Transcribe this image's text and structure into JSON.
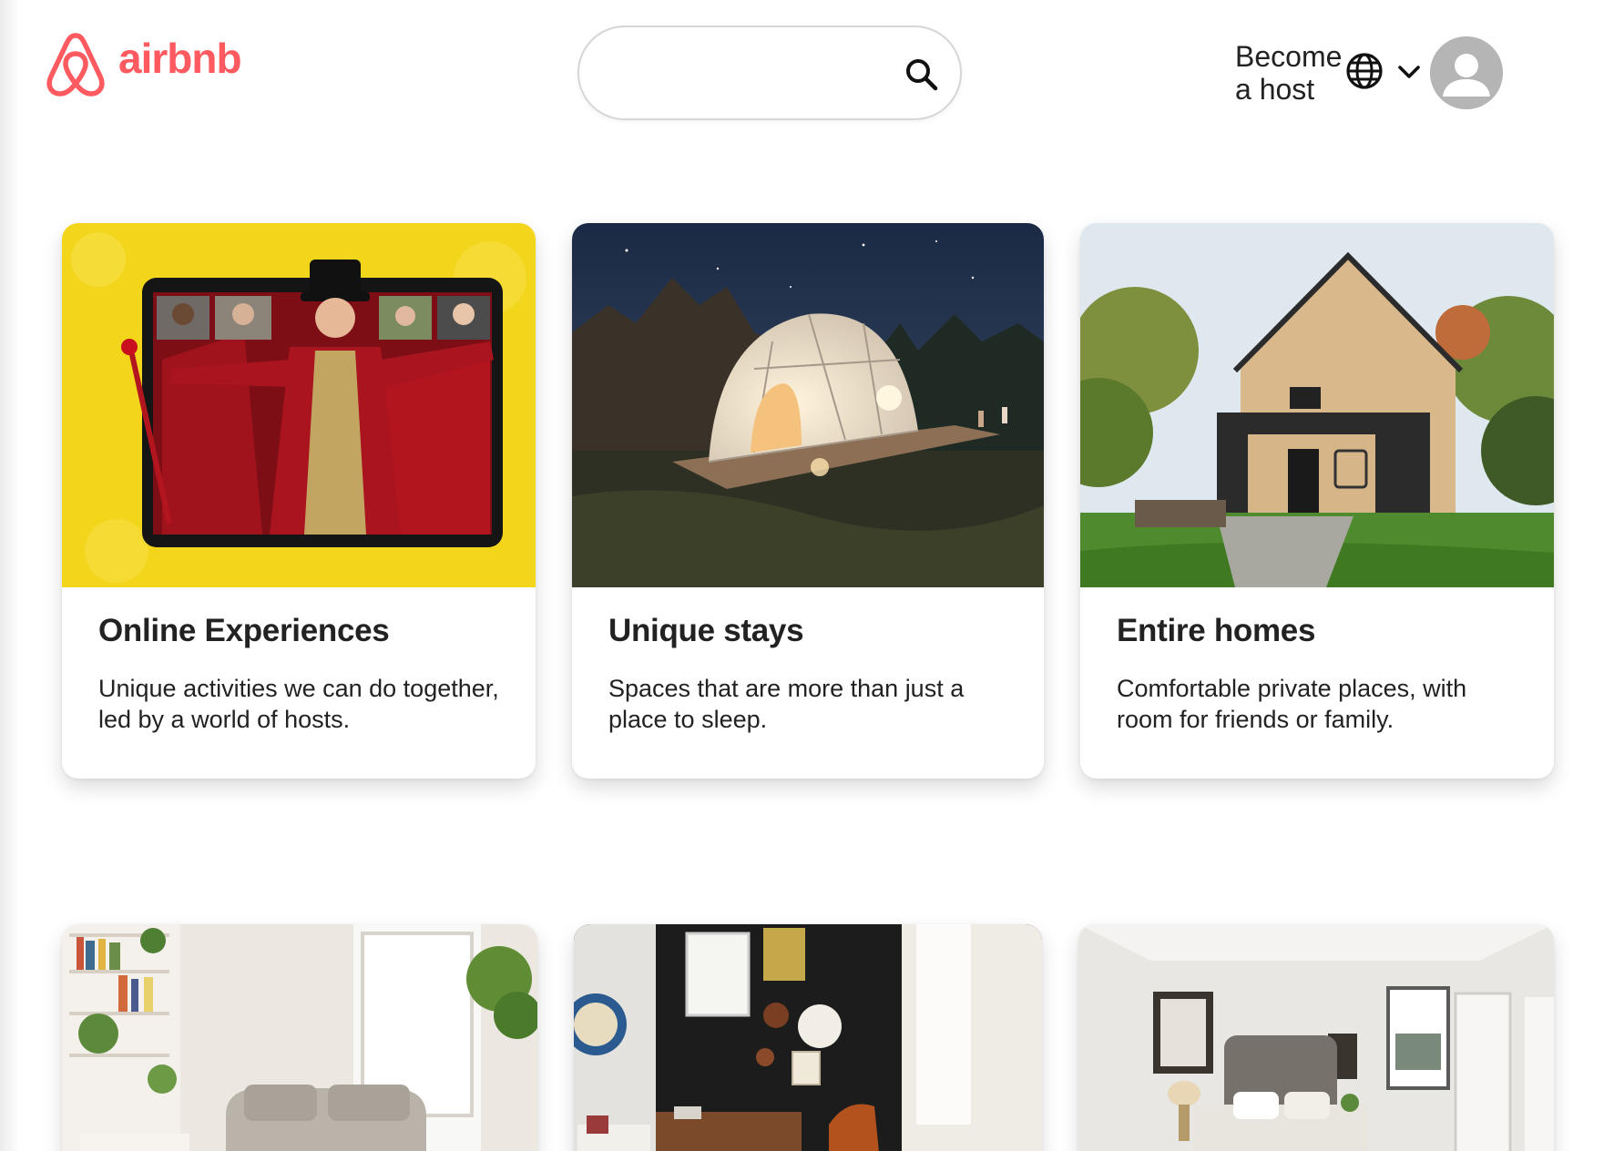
{
  "header": {
    "brand_name": "airbnb",
    "logo_icon": "airbnb-belo-icon",
    "search": {
      "placeholder": "",
      "value": "",
      "icon": "search-icon"
    },
    "host_link": "Become a host",
    "language_icon": "globe-icon",
    "menu_icon": "chevron-down-icon",
    "avatar_icon": "user-avatar-icon"
  },
  "colors": {
    "brand": "#ff5a5f",
    "text": "#222222",
    "avatar_bg": "#b5b5b5",
    "card_bg": "#ffffff"
  },
  "cards": [
    {
      "title": "Online Experiences",
      "description": "Unique activities we can do together, led by a world of hosts.",
      "image": "ringmaster-on-tablet-video-call-photo"
    },
    {
      "title": "Unique stays",
      "description": "Spaces that are more than just a place to sleep.",
      "image": "geodesic-dome-at-night-photo"
    },
    {
      "title": "Entire homes",
      "description": "Comfortable private places, with room for friends or family.",
      "image": "modern-a-frame-cabin-photo"
    },
    {
      "title": "",
      "description": "",
      "image": "bright-living-room-with-bookshelves-photo"
    },
    {
      "title": "",
      "description": "",
      "image": "dark-wall-living-room-photo"
    },
    {
      "title": "",
      "description": "",
      "image": "bedroom-with-tufted-headboard-photo"
    }
  ]
}
